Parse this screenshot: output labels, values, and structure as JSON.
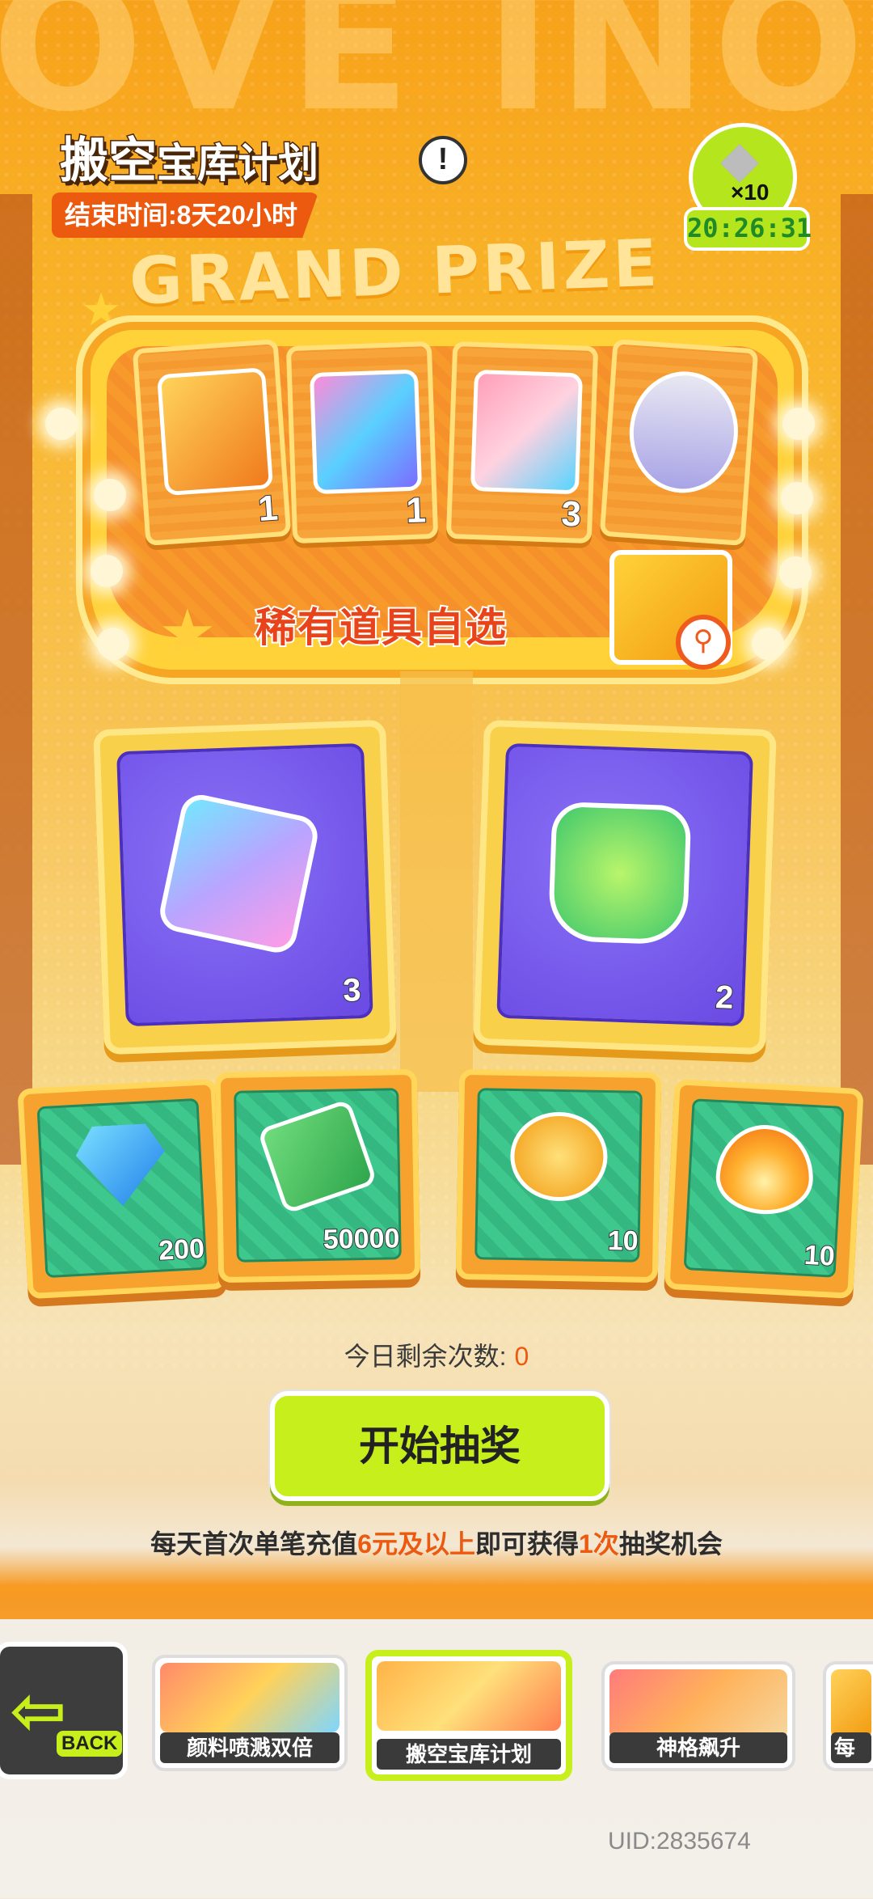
{
  "header": {
    "title_big": "搬空",
    "title_rest": "宝库计划",
    "info_icon": "exclamation-icon",
    "end_time": "结束时间:8天20小时"
  },
  "currency": {
    "icon": "diamond-icon",
    "multiplier": "×10",
    "timer": "20:26:31"
  },
  "grand_prize": {
    "title": "GRAND PRIZE",
    "items": [
      {
        "icon": "cosmetic-box-icon",
        "count": "1"
      },
      {
        "icon": "holo-card-icon",
        "count": "1"
      },
      {
        "icon": "pink-card-icon",
        "count": "3"
      },
      {
        "icon": "can-icon",
        "count": ""
      }
    ],
    "rare_label": "稀有道具自选",
    "rare_icon": "cool-box-icon"
  },
  "mid_prizes": [
    {
      "icon": "ticket-icon",
      "count": "3"
    },
    {
      "icon": "open-cup-icon",
      "count": "2"
    }
  ],
  "small_prizes": [
    {
      "icon": "diamond-icon",
      "count": "200"
    },
    {
      "icon": "cash-icon",
      "count": "50000"
    },
    {
      "icon": "coin-icon",
      "count": "10"
    },
    {
      "icon": "flame-icon",
      "count": "10"
    }
  ],
  "remaining": {
    "label": "今日剩余次数:",
    "value": "0"
  },
  "draw_button": "开始抽奖",
  "note": {
    "part1": "每天首次单笔充值",
    "hl1": "6元及以上",
    "part2": "即可获得",
    "hl2": "1次",
    "part3": "抽奖机会"
  },
  "nav": {
    "back_label": "BACK",
    "tabs": [
      {
        "label": "颜料喷溅双倍"
      },
      {
        "label": "搬空宝库计划"
      },
      {
        "label": "神格飙升"
      },
      {
        "label": "每日"
      }
    ]
  },
  "uid": "UID:2835674",
  "colors": {
    "accent": "#c6ef1c",
    "orange": "#ec5a10",
    "purple": "#6a4ae3",
    "green": "#3fc88e"
  }
}
